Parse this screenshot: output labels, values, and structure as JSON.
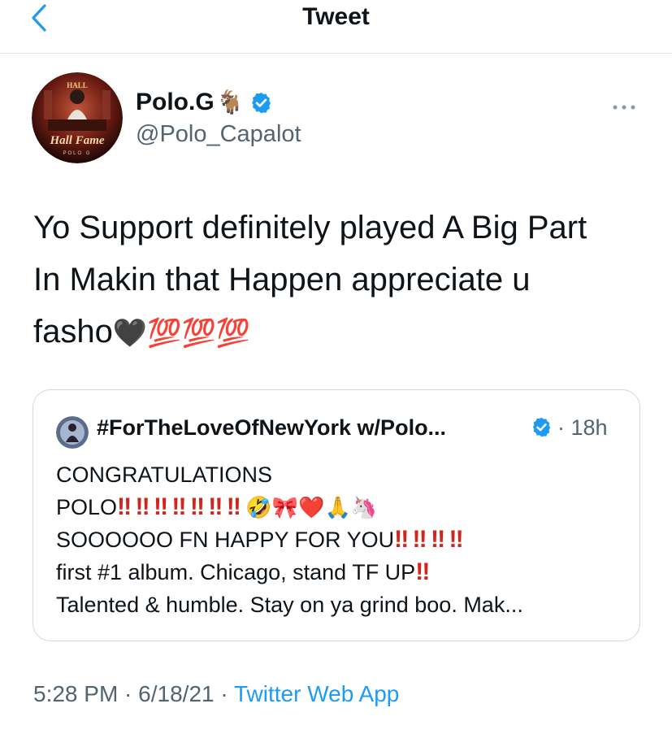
{
  "header": {
    "title": "Tweet"
  },
  "author": {
    "name": "Polo.G",
    "name_emoji": "🐐",
    "handle": "@Polo_Capalot",
    "avatar_text_top": "HALL",
    "avatar_text_main": "Hall Fame",
    "avatar_text_bottom": "POLO G"
  },
  "tweet": {
    "line1": "Yo Support definitely played A Big Part",
    "line2": "In Makin that Happen appreciate u",
    "line3_text": "fasho",
    "line3_emoji": "🖤💯💯💯"
  },
  "quote": {
    "name": "#ForTheLoveOfNewYork w/Polo...",
    "time": "· 18h",
    "lines": [
      {
        "text": "CONGRATULATIONS",
        "bangs": "",
        "emoji": ""
      },
      {
        "text": "POLO",
        "bangs": "‼ ‼ ‼ ‼ ‼ ‼ ‼",
        "emoji": "🤣🎀❤️🙏🦄"
      },
      {
        "text": "SOOOOOO FN HAPPY FOR YOU",
        "bangs": "‼ ‼ ‼ ‼",
        "emoji": ""
      },
      {
        "text": "first #1 album. Chicago, stand TF UP",
        "bangs": "‼",
        "emoji": ""
      },
      {
        "text": "Talented & humble. Stay on ya grind boo. Mak...",
        "bangs": "",
        "emoji": ""
      }
    ]
  },
  "meta": {
    "time": "5:28 PM",
    "sep1": " · ",
    "date": "6/18/21",
    "sep2": " · ",
    "source": "Twitter Web App"
  },
  "icons": {
    "back": "chevron-left-icon",
    "verified": "verified-badge-icon",
    "more": "more-dots-icon"
  },
  "colors": {
    "accent": "#1d9bf0",
    "text": "#0f1419",
    "secondary": "#536471",
    "bang_red": "#d0261c"
  }
}
